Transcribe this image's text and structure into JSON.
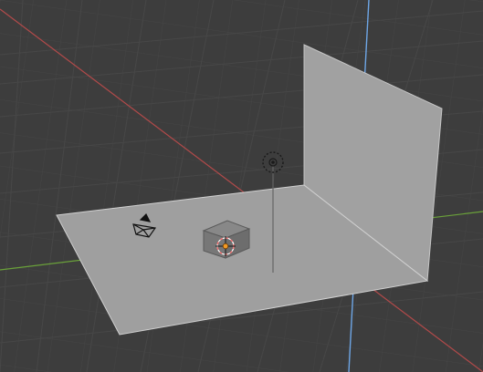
{
  "viewport": {
    "background_color": "#3d3d3d",
    "grid_color": "#464646",
    "grid_visible": true
  },
  "axes": {
    "x_axis_color": "#b24a4a",
    "y_axis_color": "#6aa13a",
    "z_axis_color": "#6ea6e6"
  },
  "scene": {
    "floor_plane_color": "#9f9f9f",
    "wall_plane_color": "#a1a1a1",
    "camera_icon": "camera-icon",
    "light_icon": "point-light-icon",
    "object_icon": "cube-icon",
    "origin_icon": "3d-cursor-icon",
    "selection_color": "#f29a25",
    "cursor_color": "#ff6a6a"
  }
}
